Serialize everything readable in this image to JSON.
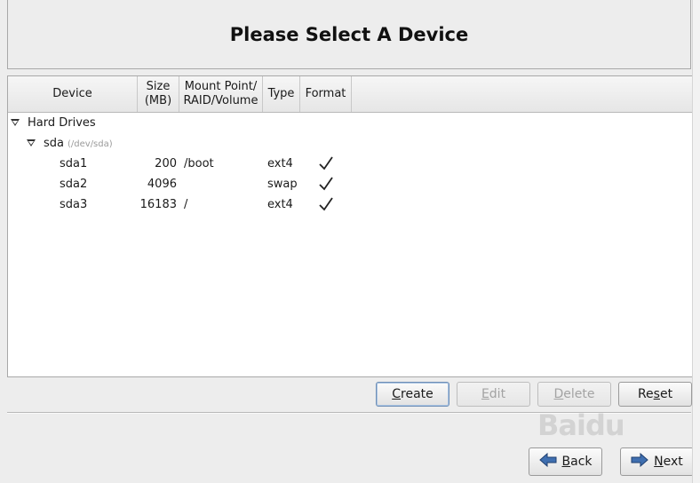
{
  "header": {
    "title": "Please Select A Device"
  },
  "columns": {
    "device": "Device",
    "size": "Size\n(MB)",
    "mount": "Mount Point/\nRAID/Volume",
    "type": "Type",
    "format": "Format"
  },
  "tree": {
    "group_label": "Hard Drives",
    "disk": {
      "name": "sda",
      "path": "(/dev/sda)"
    },
    "partitions": [
      {
        "name": "sda1",
        "size": "200",
        "mount": "/boot",
        "type": "ext4",
        "format": true
      },
      {
        "name": "sda2",
        "size": "4096",
        "mount": "",
        "type": "swap",
        "format": true
      },
      {
        "name": "sda3",
        "size": "16183",
        "mount": "/",
        "type": "ext4",
        "format": true
      }
    ]
  },
  "actions": {
    "create": {
      "label": "Create",
      "mnemonic": "C",
      "rest": "reate",
      "enabled": true
    },
    "edit": {
      "label": "Edit",
      "mnemonic": "E",
      "rest": "dit",
      "enabled": false
    },
    "delete": {
      "label": "Delete",
      "mnemonic": "D",
      "rest": "elete",
      "enabled": false
    },
    "reset": {
      "label": "Reset",
      "pre": "Re",
      "mnemonic": "s",
      "rest": "et",
      "enabled": true
    }
  },
  "navigation": {
    "back": {
      "label": "Back",
      "mnemonic": "B",
      "rest": "ack",
      "icon": "arrow-left-icon"
    },
    "next": {
      "label": "Next",
      "mnemonic": "N",
      "rest": "ext",
      "icon": "arrow-right-icon"
    }
  },
  "watermark": "Baidu"
}
